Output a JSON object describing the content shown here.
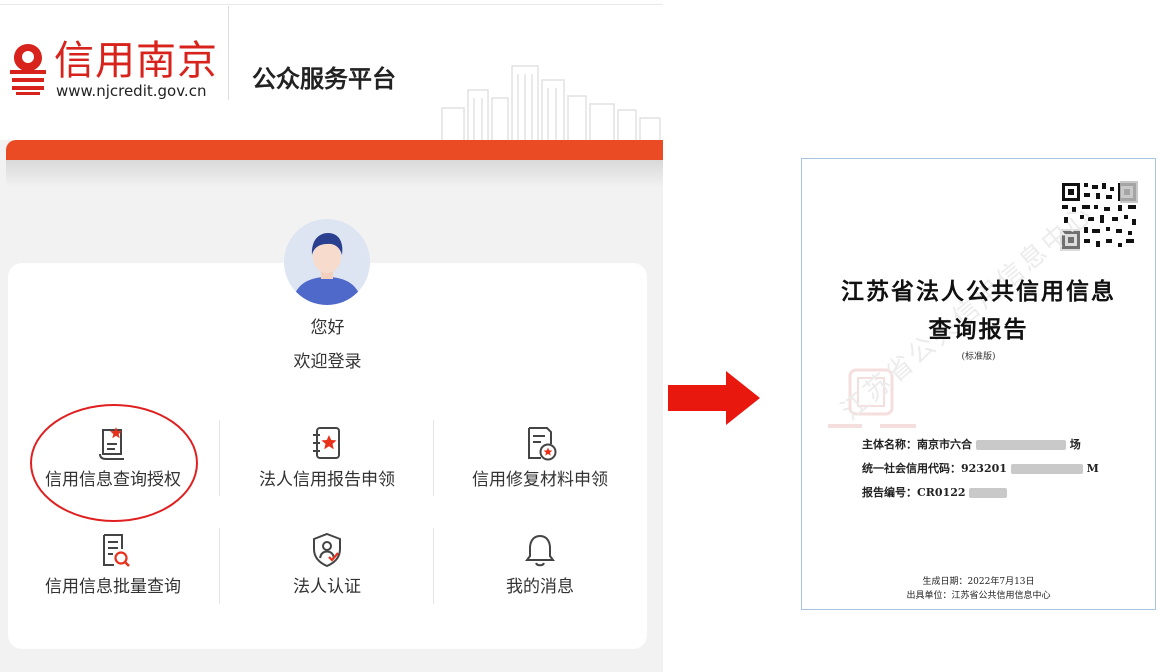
{
  "header": {
    "logo_title": "信用南京",
    "logo_url": "www.njcredit.gov.cn",
    "platform_title": "公众服务平台"
  },
  "user": {
    "greeting": "您好",
    "login_prompt": "欢迎登录"
  },
  "menu": {
    "items": [
      {
        "label": "信用信息查询授权",
        "icon": "document-star-icon"
      },
      {
        "label": "法人信用报告申领",
        "icon": "notebook-star-icon"
      },
      {
        "label": "信用修复材料申领",
        "icon": "document-badge-icon"
      },
      {
        "label": "信用信息批量查询",
        "icon": "list-search-icon"
      },
      {
        "label": "法人认证",
        "icon": "shield-user-icon"
      },
      {
        "label": "我的消息",
        "icon": "bell-icon"
      }
    ]
  },
  "report": {
    "title_line1": "江苏省法人公共信用信息",
    "title_line2": "查询报告",
    "edition": "(标准版)",
    "watermark": "江苏省公共信用信息中心",
    "subject_label": "主体名称：",
    "subject_prefix": "南京市六合",
    "subject_suffix": "场",
    "code_label": "统一社会信用代码：",
    "code_prefix": "923201",
    "code_suffix": "M",
    "number_label": "报告编号：",
    "number_prefix": "CR0122",
    "date_line": "生成日期：2022年7月13日",
    "issuer_line": "出具单位：江苏省公共信用信息中心"
  },
  "colors": {
    "brand_red": "#d7231c",
    "accent_orange": "#ea4b25",
    "annotation_red": "#e02020",
    "arrow_red": "#e8180f"
  }
}
